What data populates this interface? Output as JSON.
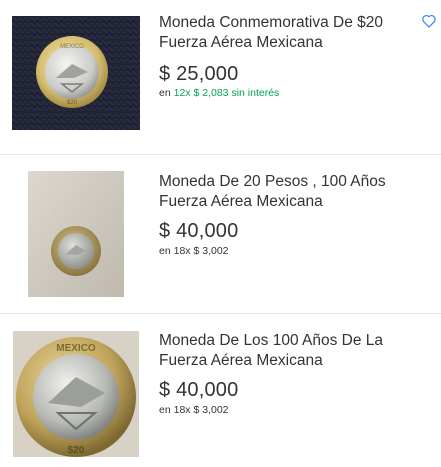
{
  "listings": [
    {
      "title": "Moneda Conmemorativa De $20 Fuerza Aérea Mexicana",
      "price": "$ 25,000",
      "installments_prefix": "en",
      "installments_count": "12x",
      "installments_amount": "$ 2,083",
      "installments_suffix": "sin interés",
      "installments_color": "#00a650"
    },
    {
      "title": "Moneda De 20 Pesos , 100 Años Fuerza Aérea Mexicana",
      "price": "$ 40,000",
      "installments_prefix": "en",
      "installments_count": "18x",
      "installments_amount": "$ 3,002"
    },
    {
      "title": "Moneda De Los 100 Años De La Fuerza Aérea Mexicana",
      "price": "$ 40,000",
      "installments_prefix": "en",
      "installments_count": "18x",
      "installments_amount": "$ 3,002"
    }
  ],
  "favorite_icon": "heart-outline-icon",
  "accent_color": "#3483fa",
  "coin_text": {
    "label": "MEXICO",
    "denomination": "$20"
  }
}
